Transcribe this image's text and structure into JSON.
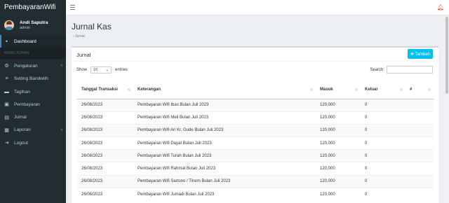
{
  "app": {
    "brand": "PembayaranWifi"
  },
  "user": {
    "name": "Andi Saputra",
    "role": "admin"
  },
  "sidebar": {
    "header": "MENU ADMIN",
    "items": [
      {
        "label": "Dashboard",
        "icon": "dashboard-icon",
        "glyph": "▪"
      },
      {
        "label": "Pengaturan",
        "icon": "gear-icon",
        "glyph": "⚙",
        "chevron": "‹"
      },
      {
        "label": "Setting Bandwith",
        "icon": "server-icon",
        "glyph": "≡"
      },
      {
        "label": "Tagihan",
        "icon": "folder-icon",
        "glyph": "▬"
      },
      {
        "label": "Pembayaran",
        "icon": "money-icon",
        "glyph": "▣"
      },
      {
        "label": "Jurnal",
        "icon": "journal-icon",
        "glyph": "▤"
      },
      {
        "label": "Laporan",
        "icon": "briefcase-icon",
        "glyph": "▦",
        "chevron": "‹"
      },
      {
        "label": "Logout",
        "icon": "logout-icon",
        "glyph": "⇥"
      }
    ]
  },
  "page": {
    "title": "Jurnal Kas",
    "breadcrumb": "› Jurnal"
  },
  "box": {
    "title": "Jurnal",
    "add_label": "✚ Tambah"
  },
  "table_controls": {
    "show_label": "Show",
    "entries_value": "10",
    "entries_label": "entries",
    "search_label": "Search:"
  },
  "table": {
    "headers": [
      "Tanggal Transaksi",
      "Keterangan",
      "Masuk",
      "Keluar",
      "#"
    ],
    "rows": [
      [
        "26/08/2023",
        "Pembayaran Wifi Ibas Bulan Juli 2023",
        "120,000",
        "0",
        ""
      ],
      [
        "26/08/2023",
        "Pembayaran Wifi Meli Bulan Juli 2023",
        "120,000",
        "0",
        ""
      ],
      [
        "26/08/2023",
        "Pembayaran Wifi Ari Kr. Gude Bulan Juli 2023",
        "120,000",
        "0",
        ""
      ],
      [
        "26/08/2023",
        "Pembayaran Wifi Dayat Bulan Juli 2023",
        "120,000",
        "0",
        ""
      ],
      [
        "26/08/2023",
        "Pembayaran Wifi Turah Bulan Juli 2023",
        "120,000",
        "0",
        ""
      ],
      [
        "26/08/2023",
        "Pembayaran Wifi Rahmat Bulan Juli 2023",
        "120,000",
        "0",
        ""
      ],
      [
        "26/08/2023",
        "Pembayaran Wifi Sartono / Tinem Bulan Juli 2023",
        "120,000",
        "0",
        ""
      ],
      [
        "26/08/2023",
        "Pembayaran Wifi Jumadi Bulan Juli 2023",
        "120,000",
        "0",
        ""
      ]
    ]
  },
  "colors": {
    "sidebar": "#222d32",
    "accent": "#3c8dbc",
    "add_button": "#00c0ef"
  }
}
